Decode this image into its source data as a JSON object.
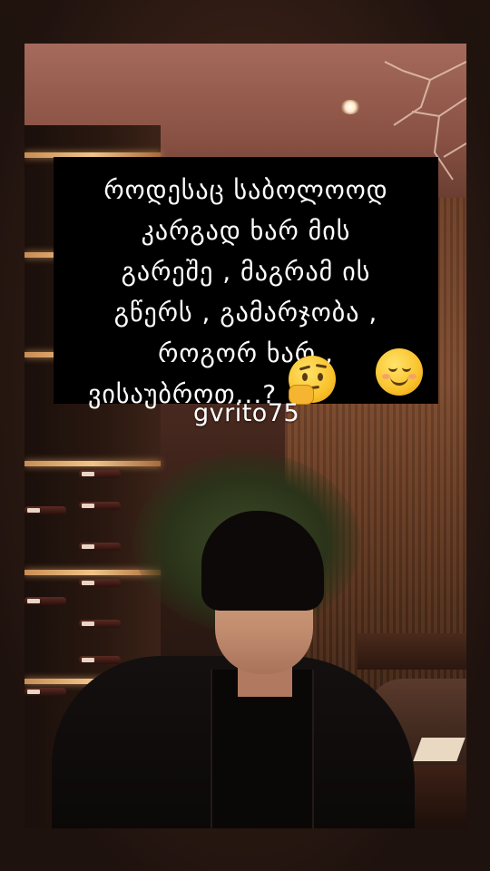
{
  "caption": {
    "lines": [
      "როდესაც საბოლოოდ",
      "კარგად ხარ მის",
      "გარეშე , მაგრამ ის",
      "გწერს , გამარჯობა ,",
      "როგორ ხარ ,",
      "ვისაუბროთ...?"
    ]
  },
  "emojis": [
    "thinking-face-icon",
    "smiling-face-icon"
  ],
  "watermark": "gvrito75"
}
